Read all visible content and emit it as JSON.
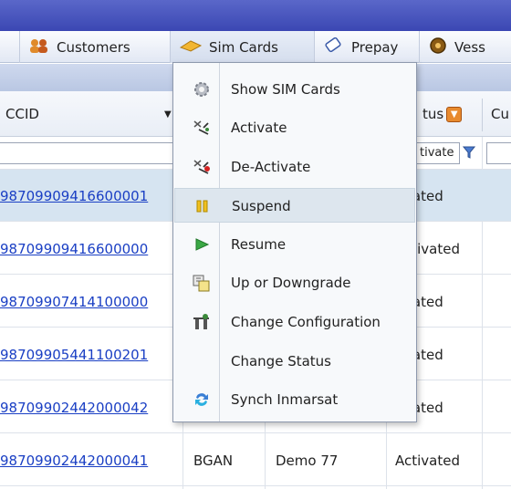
{
  "nav": {
    "tabs": [
      {
        "label": "Customers",
        "icon": "customers-icon"
      },
      {
        "label": "Sim Cards",
        "icon": "sim-card-icon"
      },
      {
        "label": "Prepay",
        "icon": "prepay-icon"
      },
      {
        "label": "Vess",
        "icon": "vessel-icon"
      }
    ]
  },
  "columns": {
    "iccid": "CCID",
    "status": "tus",
    "cu": "Cu"
  },
  "filters": {
    "status_value": "tivate"
  },
  "rows": [
    {
      "iccid": "98709909416600001",
      "col2": "",
      "col3": "",
      "status": "tivated"
    },
    {
      "iccid": "98709909416600000",
      "col2": "",
      "col3": "",
      "status": "Activated"
    },
    {
      "iccid": "98709907414100000",
      "col2": "",
      "col3": "",
      "status": "tivated"
    },
    {
      "iccid": "98709905441100201",
      "col2": "",
      "col3": "",
      "status": "tivated"
    },
    {
      "iccid": "98709902442000042",
      "col2": "",
      "col3": "",
      "status": "tivated"
    },
    {
      "iccid": "98709902442000041",
      "col2": "BGAN",
      "col3": "Demo 77",
      "status": "Activated"
    }
  ],
  "menu": {
    "items": [
      {
        "label": "Show SIM Cards",
        "icon": "gear-icon"
      },
      {
        "label": "Activate",
        "icon": "activate-icon"
      },
      {
        "label": "De-Activate",
        "icon": "deactivate-icon"
      },
      {
        "label": "Suspend",
        "icon": "pause-icon"
      },
      {
        "label": "Resume",
        "icon": "play-icon"
      },
      {
        "label": "Up or Downgrade",
        "icon": "upgrade-icon"
      },
      {
        "label": "Change Configuration",
        "icon": "configuration-icon"
      },
      {
        "label": "Change Status",
        "icon": ""
      },
      {
        "label": "Synch Inmarsat",
        "icon": "sync-icon"
      }
    ]
  },
  "colors": {
    "link": "#1a3fc4",
    "selected_row": "#d6e4f1",
    "topbar": "#3b47b3"
  }
}
